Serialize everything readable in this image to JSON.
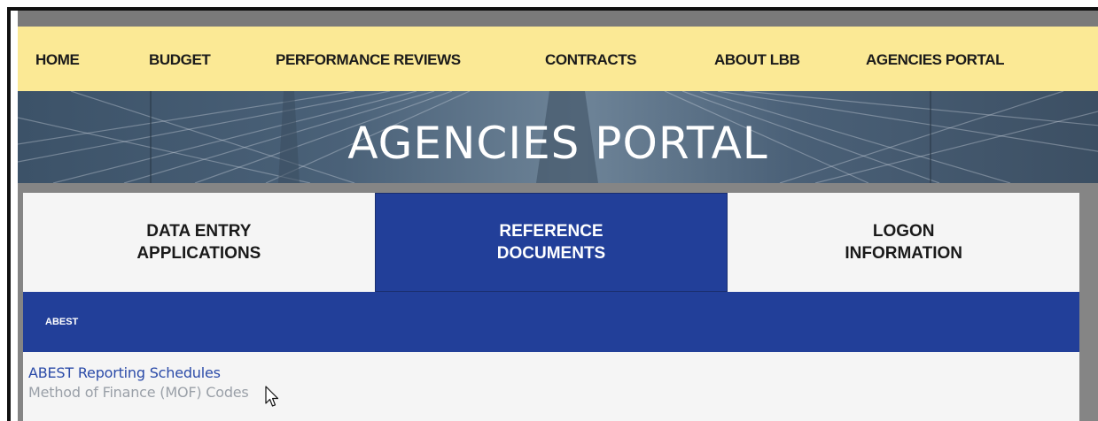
{
  "nav": {
    "items": [
      {
        "label": "HOME"
      },
      {
        "label": "BUDGET"
      },
      {
        "label": "PERFORMANCE REVIEWS"
      },
      {
        "label": "CONTRACTS"
      },
      {
        "label": "ABOUT LBB"
      },
      {
        "label": "AGENCIES PORTAL"
      }
    ]
  },
  "banner": {
    "title": "AGENCIES PORTAL"
  },
  "tabs": [
    {
      "label": "DATA ENTRY\nAPPLICATIONS",
      "active": false
    },
    {
      "label": "REFERENCE\nDOCUMENTS",
      "active": true
    },
    {
      "label": "LOGON\nINFORMATION",
      "active": false
    }
  ],
  "section": {
    "label": "ABEST"
  },
  "documents": [
    {
      "label": "ABEST Reporting Schedules"
    },
    {
      "label": "Method of Finance (MOF) Codes"
    }
  ],
  "colors": {
    "nav_bg": "#fbe995",
    "accent": "#223f99",
    "link": "#2a4aa8",
    "link_hover": "#9aa0a8"
  }
}
